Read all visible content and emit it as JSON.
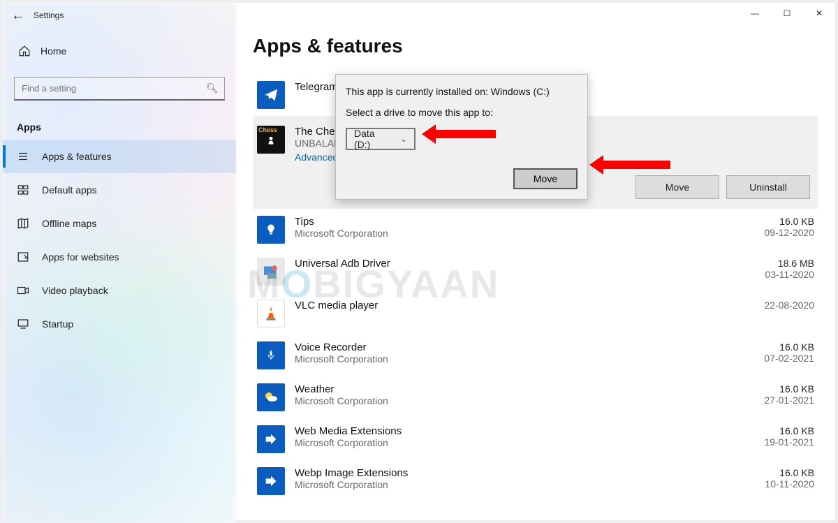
{
  "window": {
    "title": "Settings",
    "controls": {
      "min": "—",
      "max": "☐",
      "close": "✕"
    }
  },
  "sidebar": {
    "home_label": "Home",
    "search_placeholder": "Find a setting",
    "group": "Apps",
    "items": [
      {
        "label": "Apps & features",
        "icon": "list-icon",
        "active": true
      },
      {
        "label": "Default apps",
        "icon": "default-icon"
      },
      {
        "label": "Offline maps",
        "icon": "map-icon"
      },
      {
        "label": "Apps for websites",
        "icon": "websites-icon"
      },
      {
        "label": "Video playback",
        "icon": "video-icon"
      },
      {
        "label": "Startup",
        "icon": "startup-icon"
      }
    ]
  },
  "page": {
    "heading": "Apps & features"
  },
  "apps": [
    {
      "name": "Telegram",
      "publisher": "",
      "size": "",
      "date": "",
      "icon": "telegram-icon"
    },
    {
      "name": "The Chess",
      "publisher": "UNBALAN",
      "size": "",
      "date": "",
      "icon": "chess-icon",
      "selected": true,
      "advanced_label": "Advanced",
      "move_label": "Move",
      "uninstall_label": "Uninstall"
    },
    {
      "name": "Tips",
      "publisher": "Microsoft Corporation",
      "size": "16.0 KB",
      "date": "09-12-2020",
      "icon": "tips-icon"
    },
    {
      "name": "Universal Adb Driver",
      "publisher": "",
      "size": "18.6 MB",
      "date": "03-11-2020",
      "icon": "adb-icon"
    },
    {
      "name": "VLC media player",
      "publisher": "",
      "size": "",
      "date": "22-08-2020",
      "icon": "vlc-icon"
    },
    {
      "name": "Voice Recorder",
      "publisher": "Microsoft Corporation",
      "size": "16.0 KB",
      "date": "07-02-2021",
      "icon": "voice-icon"
    },
    {
      "name": "Weather",
      "publisher": "Microsoft Corporation",
      "size": "16.0 KB",
      "date": "27-01-2021",
      "icon": "weather-icon"
    },
    {
      "name": "Web Media Extensions",
      "publisher": "Microsoft Corporation",
      "size": "16.0 KB",
      "date": "19-01-2021",
      "icon": "webmedia-icon"
    },
    {
      "name": "Webp Image Extensions",
      "publisher": "Microsoft Corporation",
      "size": "16.0 KB",
      "date": "10-11-2020",
      "icon": "webp-icon"
    }
  ],
  "dialog": {
    "line1": "This app is currently installed on: Windows (C:)",
    "line2": "Select a drive to move this app to:",
    "select_value": "Data (D:)",
    "move_label": "Move"
  },
  "watermark": {
    "pre": "M",
    "o": "O",
    "rest": "BIGYAAN"
  }
}
